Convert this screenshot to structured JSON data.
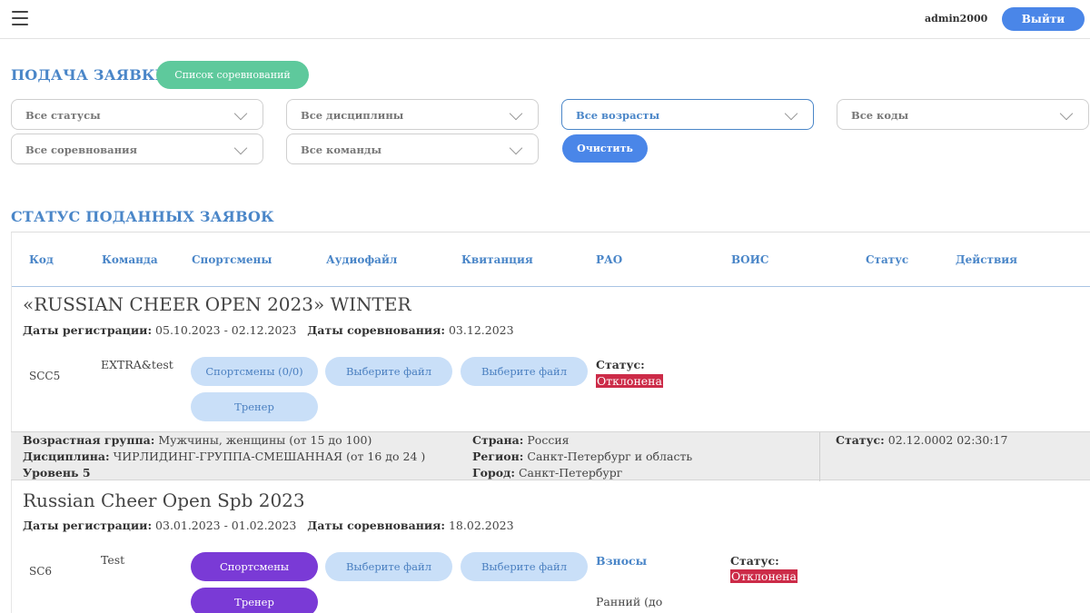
{
  "header": {
    "username": "admin2000",
    "logout_label": "Выйти"
  },
  "submit": {
    "title": "ПОДАЧА ЗАЯВКИ",
    "competitions_button": "Список соревнований",
    "filters": {
      "status": "Все статусы",
      "disciplines": "Все дисциплины",
      "ages": "Все возрасты",
      "codes": "Все коды",
      "competitions": "Все соревнования",
      "teams": "Все команды"
    },
    "clear_label": "Очистить"
  },
  "status_section": {
    "title": "СТАТУС ПОДАННЫХ ЗАЯВОК",
    "columns": [
      "Код",
      "Команда",
      "Спортсмены",
      "Аудиофайл",
      "Квитанция",
      "РАО",
      "ВОИС",
      "Статус",
      "Действия"
    ]
  },
  "competitions": [
    {
      "title": "«RUSSIAN CHEER OPEN 2023» WINTER",
      "reg_label": "Даты регистрации:",
      "reg_dates": "05.10.2023 - 02.12.2023",
      "comp_label": "Даты соревнования:",
      "comp_date": "03.12.2023",
      "entry": {
        "code": "SCC5",
        "team": "EXTRA&test",
        "athletes_button": "Спортсмены (0/0)",
        "audio_button": "Выберите файл",
        "receipt_button": "Выберите файл",
        "coach_button": "Тренер",
        "status_label": "Статус:",
        "status": "Отклонена"
      },
      "details": {
        "age_label": "Возрастная группа:",
        "age": "Мужчины, женщины (от 15 до 100)",
        "discipline_label": "Дисциплина:",
        "discipline": "ЧИРЛИДИНГ-ГРУППА-СМЕШАННАЯ (от 16 до 24 )",
        "level": "Уровень 5",
        "country_label": "Страна:",
        "country": "Россия",
        "region_label": "Регион:",
        "region": "Санкт-Петербург и область",
        "city_label": "Город:",
        "city": "Санкт-Петербург",
        "status_time_label": "Статус:",
        "status_time": "02.12.0002 02:30:17"
      }
    },
    {
      "title": "Russian Cheer Open Spb 2023",
      "reg_label": "Даты регистрации:",
      "reg_dates": "03.01.2023 - 01.02.2023",
      "comp_label": "Даты соревнования:",
      "comp_date": "18.02.2023",
      "entry": {
        "code": "SC6",
        "team": "Test",
        "athletes_button": "Спортсмены",
        "audio_button": "Выберите файл",
        "receipt_button": "Выберите файл",
        "coach_button": "Тренер",
        "fees_label": "Взносы",
        "fees_early": "Ранний (до",
        "status_label": "Статус:",
        "status": "Отклонена"
      }
    }
  ],
  "colors": {
    "accent": "#4a86e8",
    "green": "#5ec99c",
    "purple": "#7a3ad6",
    "danger": "#cc2b48"
  }
}
